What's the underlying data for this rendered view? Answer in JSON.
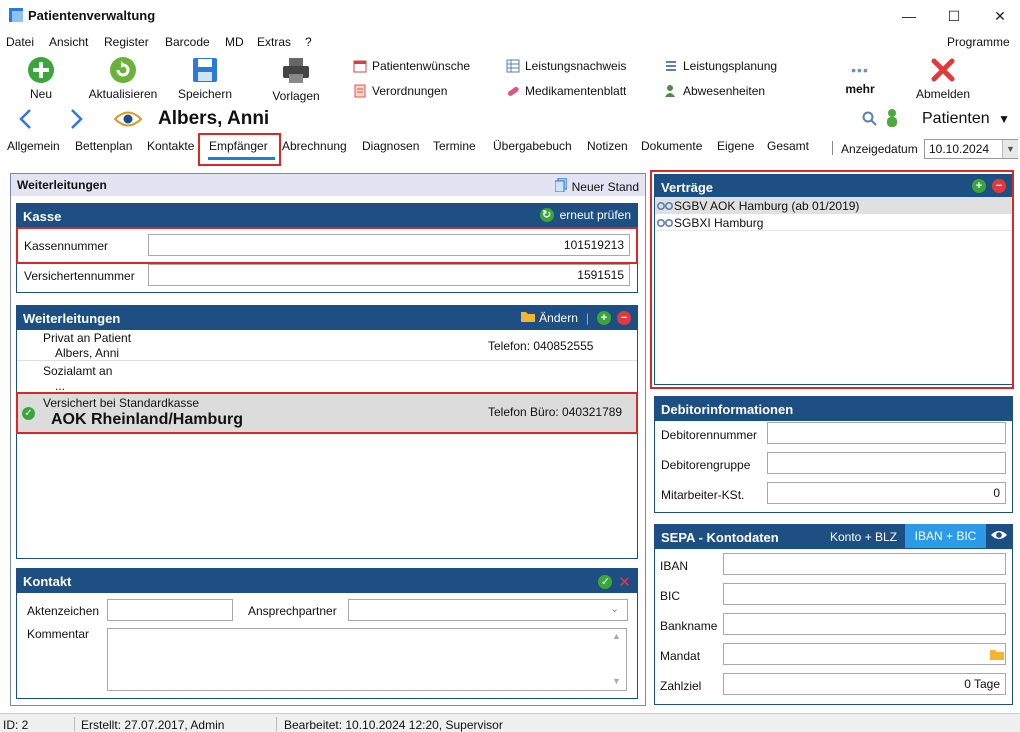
{
  "window": {
    "title": "Patientenverwaltung",
    "minimize": "—",
    "maximize": "☐",
    "close": "✕"
  },
  "menu": [
    "Datei",
    "Ansicht",
    "Register",
    "Barcode",
    "MD",
    "Extras",
    "?"
  ],
  "menu_right": "Programme",
  "toolbar": {
    "neu": "Neu",
    "aktualisieren": "Aktualisieren",
    "speichern": "Speichern",
    "vorlagen": "Vorlagen",
    "patientenwuensche": "Patientenwünsche",
    "verordnungen": "Verordnungen",
    "leistungsnachweis": "Leistungsnachweis",
    "medikamentenblatt": "Medikamentenblatt",
    "leistungsplanung": "Leistungsplanung",
    "abwesenheiten": "Abwesenheiten",
    "mehr": "mehr",
    "abmelden": "Abmelden"
  },
  "patient": {
    "name": "Albers, Anni",
    "selector": "Patienten"
  },
  "tabs": [
    "Allgemein",
    "Bettenplan",
    "Kontakte",
    "Empfänger",
    "Abrechnung",
    "Diagnosen",
    "Termine",
    "Übergabebuch",
    "Notizen",
    "Dokumente",
    "Eigene",
    "Gesamt"
  ],
  "active_tab": "Empfänger",
  "anzeigedatum": {
    "label": "Anzeigedatum",
    "value": "10.10.2024"
  },
  "weiterleitungen_outer": {
    "title": "Weiterleitungen",
    "neuer_stand": "Neuer Stand"
  },
  "kasse": {
    "title": "Kasse",
    "erneut_pruefen": "erneut prüfen",
    "kassennummer_label": "Kassennummer",
    "kassennummer": "101519213",
    "versichertennummer_label": "Versichertennummer",
    "versichertennummer": "1591515"
  },
  "weiterleitungen": {
    "title": "Weiterleitungen",
    "aendern": "Ändern",
    "rows": [
      {
        "line1": "Privat an Patient",
        "line2": "Albers, Anni",
        "phone": "Telefon: 040852555"
      },
      {
        "line1": "Sozialamt an",
        "line2": "...",
        "phone": ""
      },
      {
        "line1": "Versichert bei Standardkasse",
        "line2": "AOK Rheinland/Hamburg",
        "phone": "Telefon Büro: 040321789"
      }
    ]
  },
  "kontakt": {
    "title": "Kontakt",
    "aktenzeichen_label": "Aktenzeichen",
    "aktenzeichen": "",
    "ansprechpartner_label": "Ansprechpartner",
    "ansprechpartner": "",
    "kommentar_label": "Kommentar",
    "kommentar": ""
  },
  "vertraege": {
    "title": "Verträge",
    "items": [
      "SGBV AOK Hamburg (ab 01/2019)",
      "SGBXI Hamburg"
    ]
  },
  "debitor": {
    "title": "Debitorinformationen",
    "nummer_label": "Debitorennummer",
    "nummer": "",
    "gruppe_label": "Debitorengruppe",
    "gruppe": "",
    "kst_label": "Mitarbeiter-KSt.",
    "kst": "0"
  },
  "sepa": {
    "title": "SEPA - Kontodaten",
    "konto_blz": "Konto + BLZ",
    "iban_bic": "IBAN + BIC",
    "iban_label": "IBAN",
    "iban": "",
    "bic_label": "BIC",
    "bic": "",
    "bankname_label": "Bankname",
    "bankname": "",
    "mandat_label": "Mandat",
    "mandat": "",
    "zahlziel_label": "Zahlziel",
    "zahlziel": "0 Tage"
  },
  "status": {
    "id": "ID: 2",
    "erstellt": "Erstellt: 27.07.2017, Admin",
    "bearbeitet": "Bearbeitet: 10.10.2024 12:20, Supervisor"
  },
  "colors": {
    "panel_header": "#1e4f83",
    "highlight": "#d42a2a",
    "accent": "#1f7fd6"
  }
}
